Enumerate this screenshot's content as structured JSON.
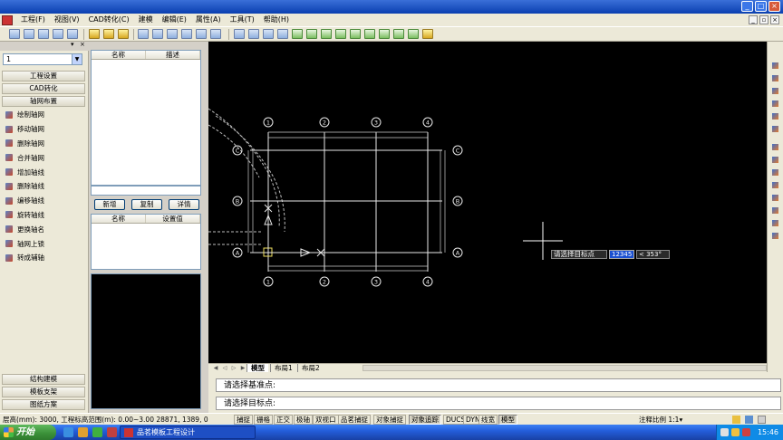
{
  "menu": [
    "工程(F)",
    "视图(V)",
    "CAD转化(C)",
    "建模",
    "编辑(E)",
    "属性(A)",
    "工具(T)",
    "帮助(H)"
  ],
  "left_panel": {
    "dropdown_value": "1",
    "categories_top": [
      "工程设置",
      "CAD转化",
      "轴网布置"
    ],
    "commands": [
      "绘制轴网",
      "移动轴网",
      "删除轴网",
      "合并轴网",
      "增加轴线",
      "删除轴线",
      "编移轴线",
      "旋转轴线",
      "更换轴名",
      "轴网上锁",
      "转成辅轴"
    ],
    "categories_bottom": [
      "结构建模",
      "模板支架",
      "图纸方案"
    ]
  },
  "middle_panel": {
    "table1_headers": [
      "名称",
      "描述"
    ],
    "buttons": [
      "新增",
      "复制",
      "详情"
    ],
    "table2_headers": [
      "名称",
      "设置值"
    ]
  },
  "drawing": {
    "column_labels": [
      "1",
      "2",
      "3",
      "4"
    ],
    "row_labels": [
      "C",
      "B",
      "A"
    ],
    "prompt_label": "请选择目标点",
    "input_value": "12345",
    "angle_value": "< 353°"
  },
  "layout_tabs": [
    "模型",
    "布局1",
    "布局2"
  ],
  "command_lines": [
    "请选择基准点:",
    "请选择目标点:"
  ],
  "status": {
    "coord_text": "层高(mm): 3000, 工程标高范围(m): 0.00~3.00  28871, 1389, 0",
    "toggles": [
      "捕捉",
      "栅格",
      "正交",
      "极轴",
      "双视口",
      "品茗捕捉",
      "对象捕捉",
      "对象追踪",
      "DUCS",
      "DYN",
      "线宽",
      "模型"
    ],
    "toggles_on": [
      "对象追踪",
      "模型"
    ],
    "annot_scale": "注释比例  1:1▾"
  },
  "taskbar": {
    "start_label": "开始",
    "task_item": "品茗模板工程设计",
    "clock": "15:46"
  },
  "colors": {
    "title_blue": "#0a3fb0",
    "canvas_bg": "#000000",
    "grid_line": "#e8e8e8",
    "highlight": "#1a4fd0",
    "start_green": "#3a8f38"
  }
}
